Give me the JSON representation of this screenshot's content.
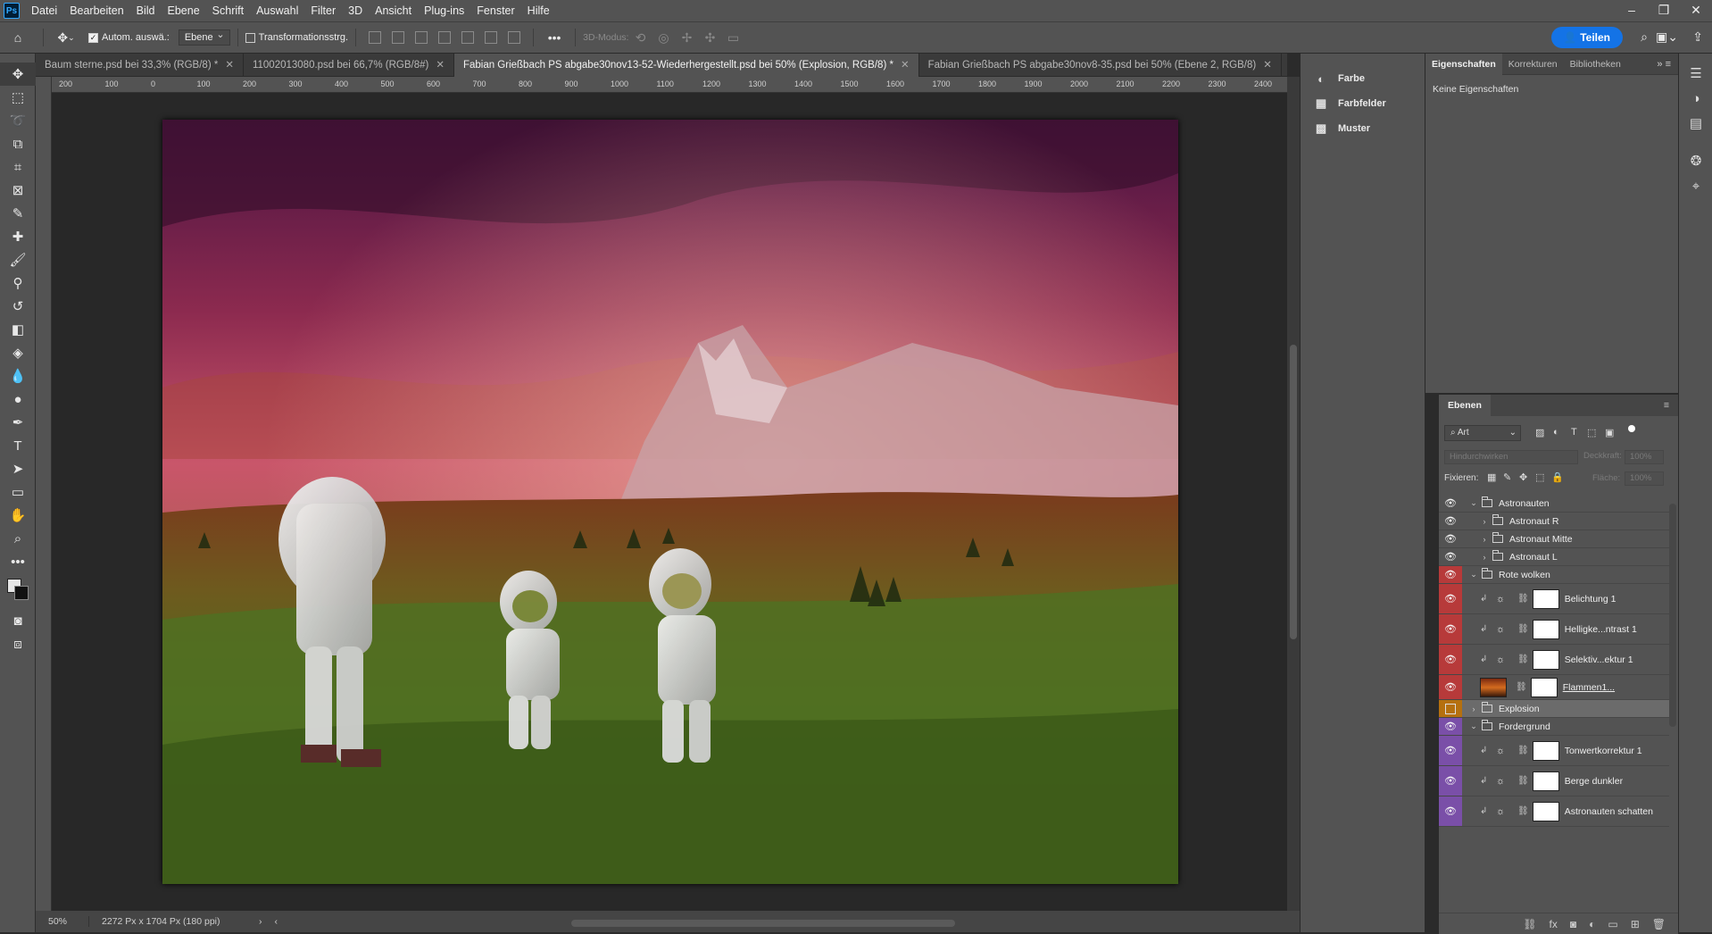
{
  "menu": {
    "logo": "Ps",
    "items": [
      "Datei",
      "Bearbeiten",
      "Bild",
      "Ebene",
      "Schrift",
      "Auswahl",
      "Filter",
      "3D",
      "Ansicht",
      "Plug-ins",
      "Fenster",
      "Hilfe"
    ]
  },
  "options": {
    "auto_select_label": "Autom. auswä.:",
    "auto_select_target": "Ebene",
    "transform_label": "Transformationsstrg.",
    "mode_3d_label": "3D-Modus:",
    "share_label": "Teilen"
  },
  "tabs": [
    {
      "label": "Baum sterne.psd bei 33,3% (RGB/8) *"
    },
    {
      "label": "11002013080.psd bei 66,7% (RGB/8#)"
    },
    {
      "label": "Fabian Grießbach PS abgabe30nov13-52-Wiederhergestellt.psd bei 50% (Explosion, RGB/8) *",
      "active": true
    },
    {
      "label": "Fabian Grießbach PS abgabe30nov8-35.psd bei 50% (Ebene 2, RGB/8)"
    }
  ],
  "ruler": {
    "h_ticks": [
      "200",
      "100",
      "0",
      "100",
      "200",
      "300",
      "400",
      "500",
      "600",
      "700",
      "800",
      "900",
      "1000",
      "1100",
      "1200",
      "1300",
      "1400",
      "1500",
      "1600",
      "1700",
      "1800",
      "1900",
      "2000",
      "2100",
      "2200",
      "2300",
      "2400"
    ]
  },
  "status": {
    "zoom": "50%",
    "doc_size": "2272 Px x 1704 Px (180 ppi)"
  },
  "mid_panel": {
    "items": [
      {
        "label": "Farbe",
        "icon": "color-palette-icon"
      },
      {
        "label": "Farbfelder",
        "icon": "swatches-grid-icon"
      },
      {
        "label": "Muster",
        "icon": "pattern-grid-icon"
      }
    ]
  },
  "properties": {
    "tabs": [
      "Eigenschaften",
      "Korrekturen",
      "Bibliotheken"
    ],
    "empty_text": "Keine Eigenschaften"
  },
  "layers": {
    "tab": "Ebenen",
    "filter_kind": "Art",
    "blend_mode": "Hindurchwirken",
    "opacity_label": "Deckkraft:",
    "opacity_value": "100%",
    "lock_label": "Fixieren:",
    "fill_label": "Fläche:",
    "fill_value": "100%",
    "rows": [
      {
        "name": "Astronauten",
        "type": "group",
        "expanded": true,
        "indent": 0,
        "color": "",
        "height": 20
      },
      {
        "name": "Astronaut R",
        "type": "group",
        "expanded": false,
        "indent": 1,
        "color": "",
        "height": 20
      },
      {
        "name": "Astronaut Mitte",
        "type": "group",
        "expanded": false,
        "indent": 1,
        "color": "",
        "height": 20
      },
      {
        "name": "Astronaut L",
        "type": "group",
        "expanded": false,
        "indent": 1,
        "color": "",
        "height": 20
      },
      {
        "name": "Rote wolken",
        "type": "group",
        "expanded": true,
        "indent": 0,
        "color": "#b73a3a",
        "height": 20
      },
      {
        "name": "Belichtung 1",
        "type": "adjustment",
        "indent": 1,
        "color": "#b73a3a",
        "height": 34
      },
      {
        "name": "Helligke...ntrast 1",
        "type": "adjustment",
        "indent": 1,
        "color": "#b73a3a",
        "height": 34
      },
      {
        "name": "Selektiv...ektur 1",
        "type": "adjustment",
        "indent": 1,
        "color": "#b73a3a",
        "height": 34
      },
      {
        "name": "Flammen1...",
        "type": "image",
        "indent": 1,
        "color": "#b73a3a",
        "height": 28
      },
      {
        "name": "Explosion",
        "type": "group",
        "expanded": false,
        "indent": 0,
        "color": "#b5700f",
        "height": 20,
        "selected": true
      },
      {
        "name": "Fordergrund",
        "type": "group",
        "expanded": true,
        "indent": 0,
        "color": "#7a4fa8",
        "height": 20
      },
      {
        "name": "Tonwertkorrektur 1",
        "type": "adjustment",
        "indent": 1,
        "color": "#7a4fa8",
        "height": 34
      },
      {
        "name": "Berge dunkler",
        "type": "adjustment",
        "indent": 1,
        "color": "#7a4fa8",
        "height": 34
      },
      {
        "name": "Astronauten schatten",
        "type": "adjustment",
        "indent": 1,
        "color": "#7a4fa8",
        "height": 34
      }
    ]
  }
}
